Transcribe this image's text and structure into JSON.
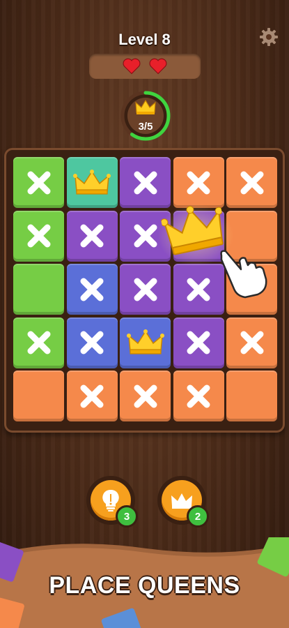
{
  "header": {
    "level_title": "Level 8",
    "lives": 2
  },
  "progress": {
    "text": "3/5",
    "fraction": 0.6
  },
  "board": {
    "rows": 5,
    "cols": 5,
    "colors": {
      "green": "#76cd45",
      "teal": "#4ec7a0",
      "purple": "#8a4fc4",
      "orange": "#f5894b",
      "blue": "#5b6fd8"
    },
    "cells": [
      [
        "green:x",
        "teal:crown",
        "purple:x",
        "orange:x",
        "orange:x"
      ],
      [
        "green:x",
        "purple:x",
        "purple:x",
        "purple:empty",
        "orange:empty"
      ],
      [
        "green:empty",
        "blue:x",
        "purple:x",
        "purple:x",
        "orange:empty"
      ],
      [
        "green:x",
        "blue:x",
        "blue:crown",
        "purple:x",
        "orange:x"
      ],
      [
        "orange:empty",
        "orange:x",
        "orange:x",
        "orange:x",
        "orange:empty"
      ]
    ]
  },
  "boosters": {
    "hint": {
      "icon": "lightbulb-icon",
      "count": "3"
    },
    "crown": {
      "icon": "crown-icon",
      "count": "2"
    }
  },
  "footer": {
    "caption": "PLACE QUEENS"
  }
}
